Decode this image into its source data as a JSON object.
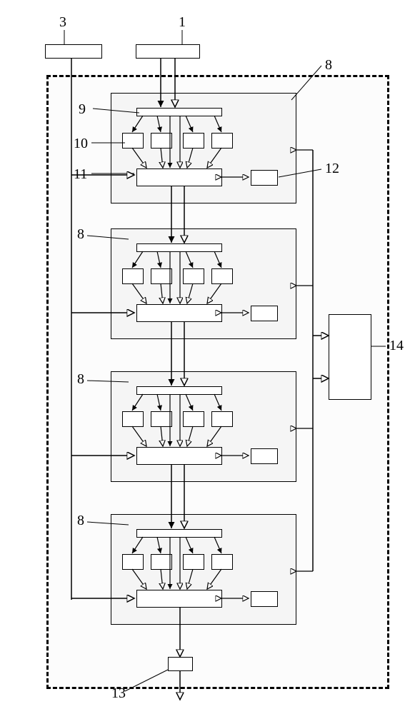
{
  "diagram": {
    "labels": {
      "l1": "1",
      "l3": "3",
      "l8a": "8",
      "l8b": "8",
      "l8c": "8",
      "l8d": "8",
      "l9": "9",
      "l10": "10",
      "l11": "11",
      "l12": "12",
      "l13": "13",
      "l14": "14"
    }
  }
}
